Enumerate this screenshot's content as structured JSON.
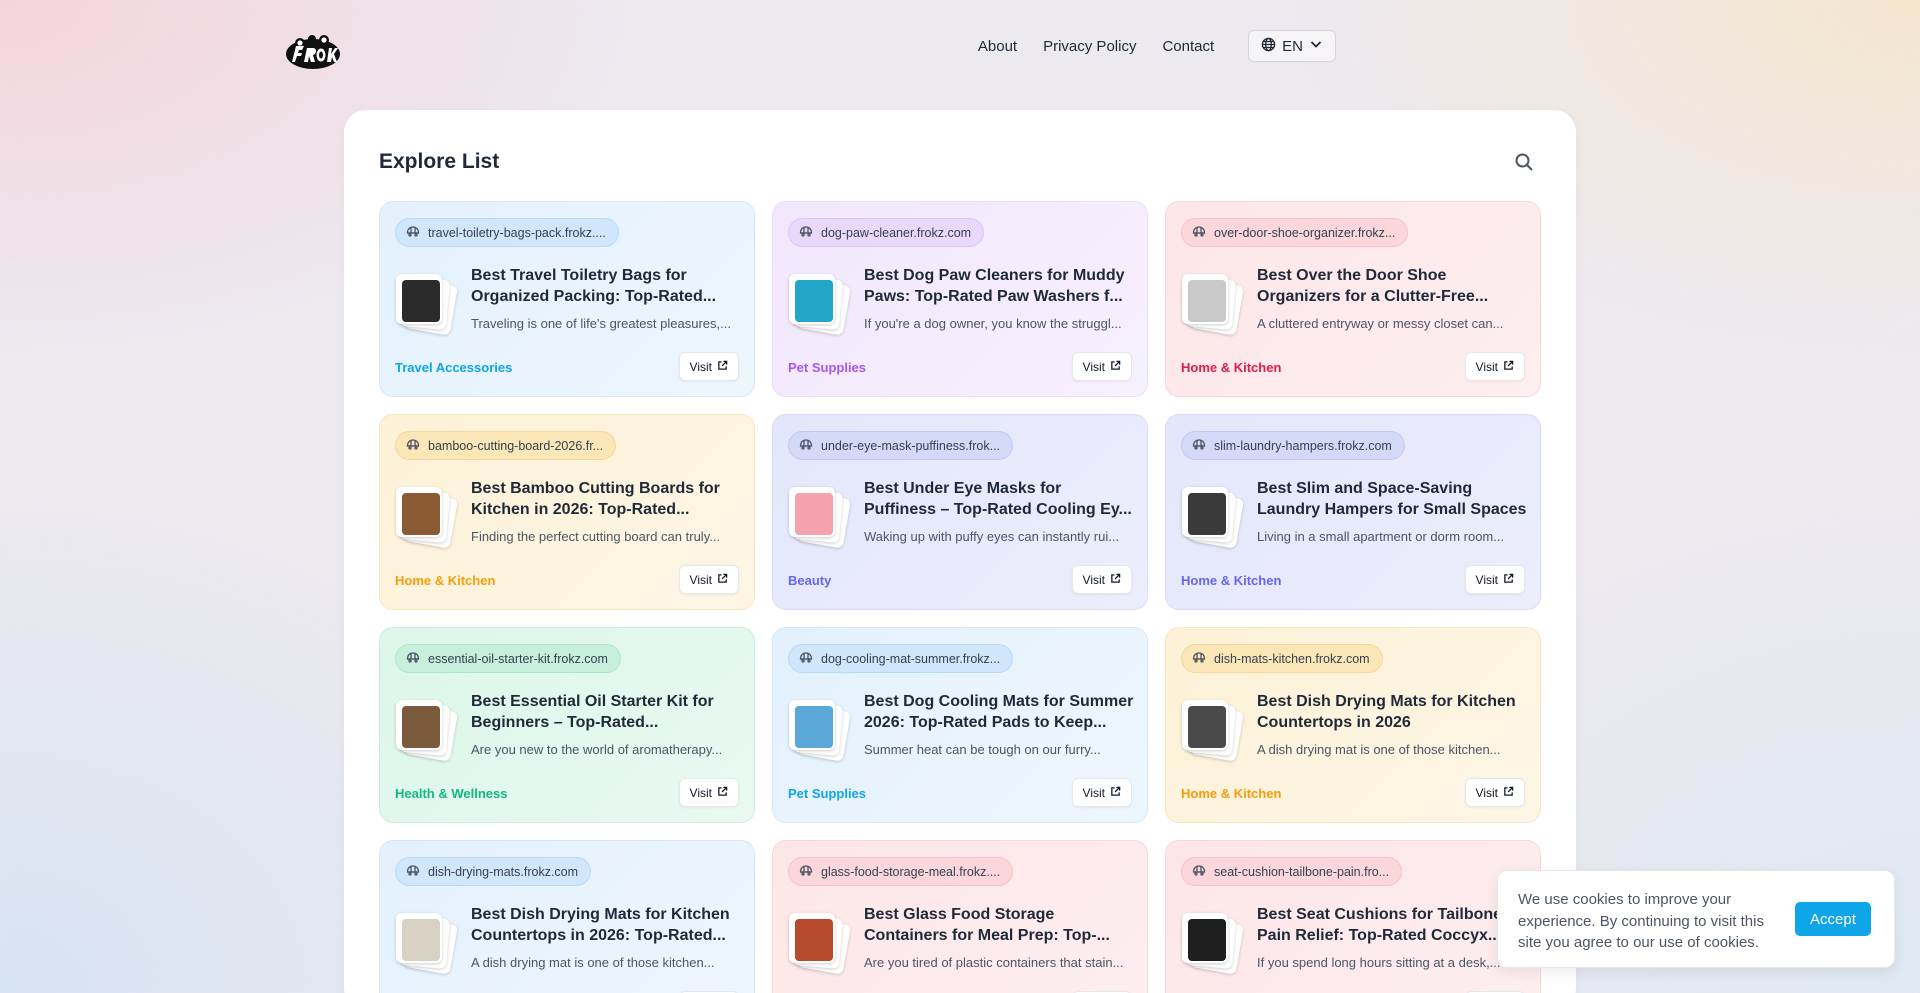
{
  "nav": {
    "links": [
      "About",
      "Privacy Policy",
      "Contact"
    ],
    "language": "EN"
  },
  "panel": {
    "title": "Explore List"
  },
  "cards": [
    {
      "domain": "travel-toiletry-bags-pack.frokz....",
      "title": "Best Travel Toiletry Bags for Organized Packing: Top-Rated...",
      "desc": "Traveling is one of life's greatest pleasures,...",
      "category": "Travel Accessories",
      "visit": "Visit",
      "theme": "blue",
      "category_color": "#0ea5e9",
      "thumb_color": "#2b2b2b"
    },
    {
      "domain": "dog-paw-cleaner.frokz.com",
      "title": "Best Dog Paw Cleaners for Muddy Paws: Top-Rated Paw Washers f...",
      "desc": "If you're a dog owner, you know the struggl...",
      "category": "Pet Supplies",
      "visit": "Visit",
      "theme": "purple",
      "category_color": "#a855f7",
      "thumb_color": "#22a6c8"
    },
    {
      "domain": "over-door-shoe-organizer.frokz...",
      "title": "Best Over the Door Shoe Organizers for a Clutter-Free...",
      "desc": "A cluttered entryway or messy closet can...",
      "category": "Home & Kitchen",
      "visit": "Visit",
      "theme": "pink",
      "category_color": "#e11d48",
      "thumb_color": "#c9c9c9"
    },
    {
      "domain": "bamboo-cutting-board-2026.fr...",
      "title": "Best Bamboo Cutting Boards for Kitchen in 2026: Top-Rated...",
      "desc": "Finding the perfect cutting board can truly...",
      "category": "Home & Kitchen",
      "visit": "Visit",
      "theme": "yellow",
      "category_color": "#f59e0b",
      "thumb_color": "#8a5a34"
    },
    {
      "domain": "under-eye-mask-puffiness.frok...",
      "title": "Best Under Eye Masks for Puffiness – Top-Rated Cooling Ey...",
      "desc": "Waking up with puffy eyes can instantly rui...",
      "category": "Beauty",
      "visit": "Visit",
      "theme": "indigo",
      "category_color": "#6366f1",
      "thumb_color": "#f3a2ae"
    },
    {
      "domain": "slim-laundry-hampers.frokz.com",
      "title": "Best Slim and Space-Saving Laundry Hampers for Small Spaces",
      "desc": "Living in a small apartment or dorm room...",
      "category": "Home & Kitchen",
      "visit": "Visit",
      "theme": "indigo",
      "category_color": "#6366f1",
      "thumb_color": "#3a3a3a"
    },
    {
      "domain": "essential-oil-starter-kit.frokz.com",
      "title": "Best Essential Oil Starter Kit for Beginners – Top-Rated...",
      "desc": "Are you new to the world of aromatherapy...",
      "category": "Health & Wellness",
      "visit": "Visit",
      "theme": "green",
      "category_color": "#10b981",
      "thumb_color": "#7a5a3a"
    },
    {
      "domain": "dog-cooling-mat-summer.frokz...",
      "title": "Best Dog Cooling Mats for Summer 2026: Top-Rated Pads to Keep...",
      "desc": "Summer heat can be tough on our furry...",
      "category": "Pet Supplies",
      "visit": "Visit",
      "theme": "blue",
      "category_color": "#0ea5e9",
      "thumb_color": "#5aa7d8"
    },
    {
      "domain": "dish-mats-kitchen.frokz.com",
      "title": "Best Dish Drying Mats for Kitchen Countertops in 2026",
      "desc": "A dish drying mat is one of those kitchen...",
      "category": "Home & Kitchen",
      "visit": "Visit",
      "theme": "yellow",
      "category_color": "#f59e0b",
      "thumb_color": "#4a4a4a"
    },
    {
      "domain": "dish-drying-mats.frokz.com",
      "title": "Best Dish Drying Mats for Kitchen Countertops in 2026: Top-Rated...",
      "desc": "A dish drying mat is one of those kitchen...",
      "category": "",
      "visit": "Visit",
      "theme": "blue",
      "category_color": "#0ea5e9",
      "thumb_color": "#d8d2c4"
    },
    {
      "domain": "glass-food-storage-meal.frokz....",
      "title": "Best Glass Food Storage Containers for Meal Prep: Top-...",
      "desc": "Are you tired of plastic containers that stain...",
      "category": "",
      "visit": "Visit",
      "theme": "pink",
      "category_color": "#e11d48",
      "thumb_color": "#b84a2e"
    },
    {
      "domain": "seat-cushion-tailbone-pain.fro...",
      "title": "Best Seat Cushions for Tailbone Pain Relief: Top-Rated Coccyx...",
      "desc": "If you spend long hours sitting at a desk,...",
      "category": "",
      "visit": "Visit",
      "theme": "pink",
      "category_color": "#e11d48",
      "thumb_color": "#1f1f1f"
    }
  ],
  "cookie": {
    "text": "We use cookies to improve your experience. By continuing to visit this site you agree to our use of cookies.",
    "accept": "Accept"
  },
  "icons": {
    "globe": "globe-icon",
    "chevron": "chevron-down-icon",
    "search": "search-icon",
    "pill": "web-icon",
    "external": "external-link-icon"
  }
}
